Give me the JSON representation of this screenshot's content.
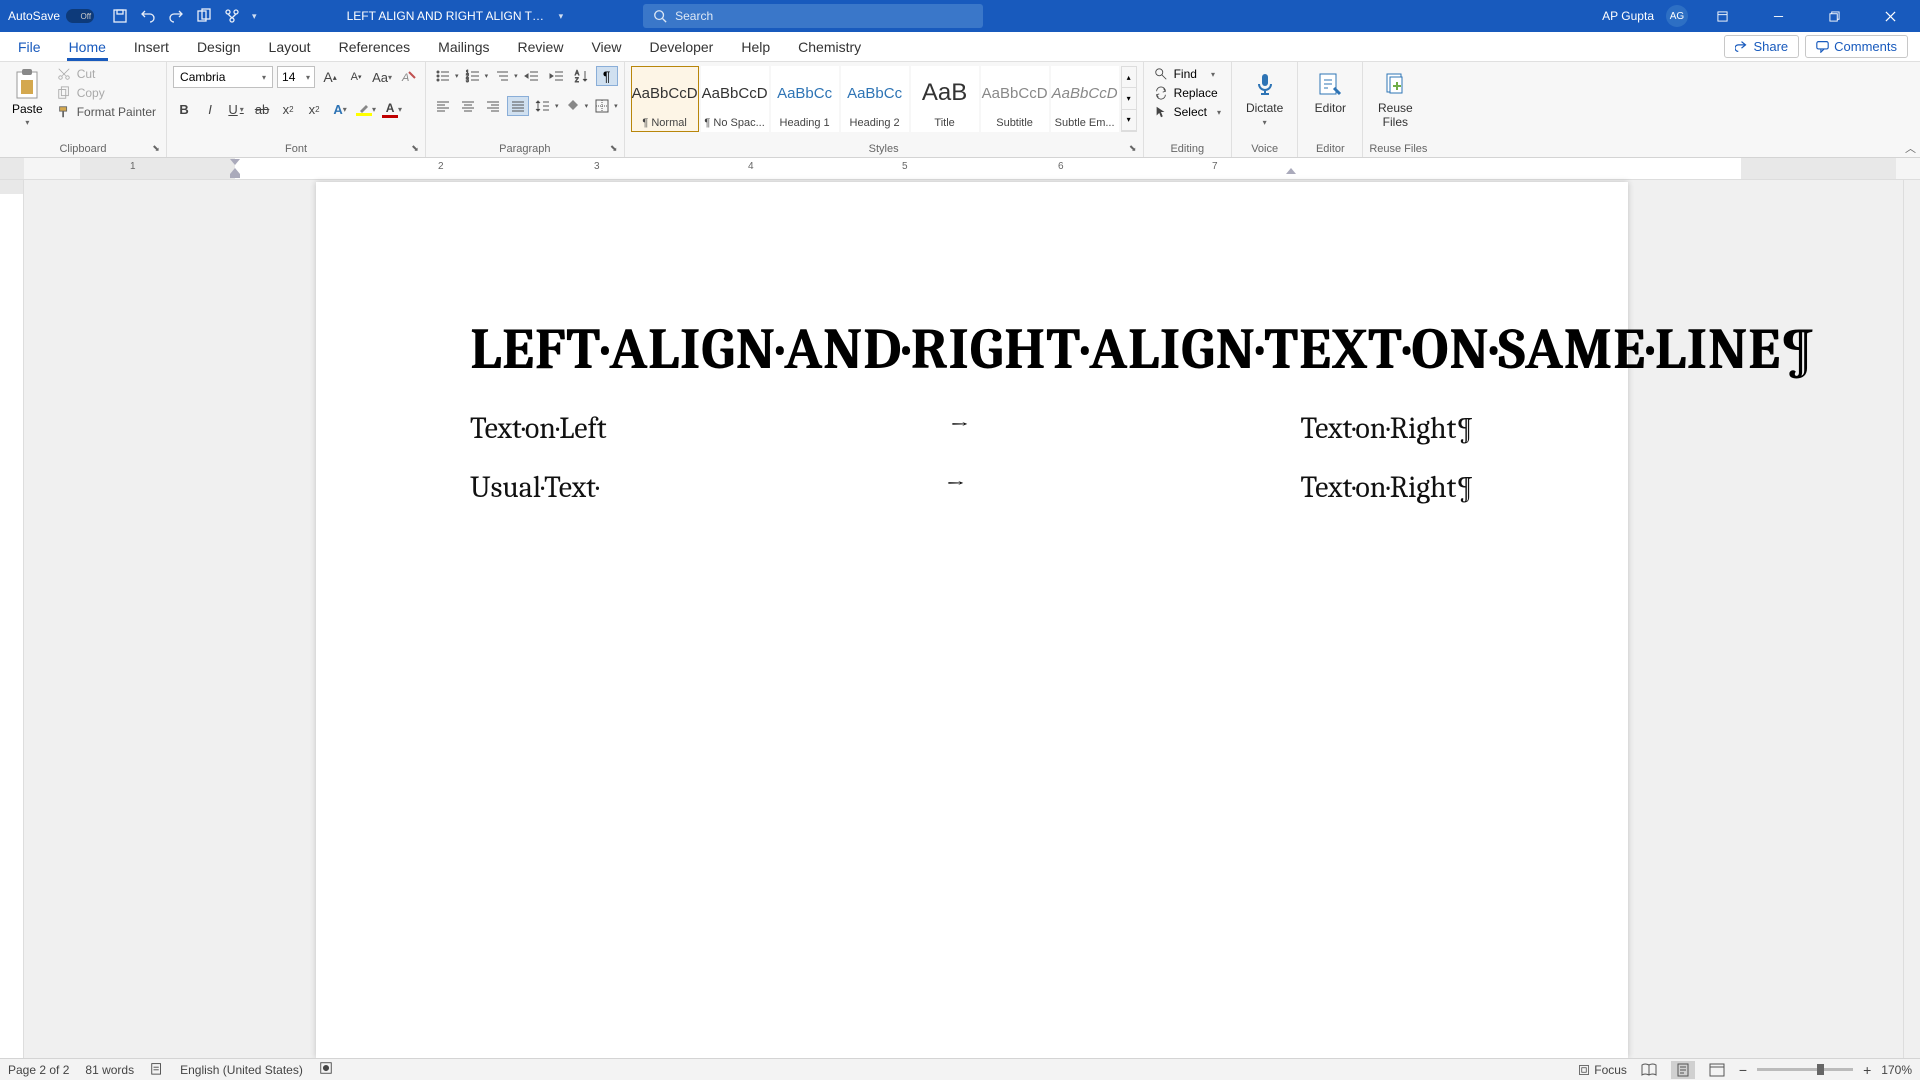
{
  "titlebar": {
    "autosave_label": "AutoSave",
    "autosave_state": "Off",
    "doc_title": "LEFT ALIGN AND RIGHT ALIGN TEXT...",
    "search_placeholder": "Search",
    "user_name": "AP Gupta",
    "user_initials": "AG"
  },
  "tabs": {
    "file": "File",
    "home": "Home",
    "insert": "Insert",
    "design": "Design",
    "layout": "Layout",
    "references": "References",
    "mailings": "Mailings",
    "review": "Review",
    "view": "View",
    "developer": "Developer",
    "help": "Help",
    "chemistry": "Chemistry",
    "share": "Share",
    "comments": "Comments"
  },
  "clipboard": {
    "paste": "Paste",
    "cut": "Cut",
    "copy": "Copy",
    "format_painter": "Format Painter",
    "group": "Clipboard"
  },
  "font": {
    "name": "Cambria",
    "size": "14",
    "group": "Font"
  },
  "paragraph": {
    "group": "Paragraph"
  },
  "styles": {
    "group": "Styles",
    "items": [
      {
        "preview": "AaBbCcD",
        "label": "¶ Normal",
        "cls": ""
      },
      {
        "preview": "AaBbCcD",
        "label": "¶ No Spac...",
        "cls": ""
      },
      {
        "preview": "AaBbCc",
        "label": "Heading 1",
        "cls": "heading"
      },
      {
        "preview": "AaBbCc",
        "label": "Heading 2",
        "cls": "heading"
      },
      {
        "preview": "AaB",
        "label": "Title",
        "cls": "title"
      },
      {
        "preview": "AaBbCcD",
        "label": "Subtitle",
        "cls": ""
      },
      {
        "preview": "AaBbCcD",
        "label": "Subtle Em...",
        "cls": "subtle"
      }
    ]
  },
  "editing": {
    "find": "Find",
    "replace": "Replace",
    "select": "Select",
    "group": "Editing"
  },
  "voice": {
    "dictate": "Dictate",
    "group": "Voice"
  },
  "editor": {
    "label": "Editor",
    "group": "Editor"
  },
  "reuse": {
    "label": "Reuse\nFiles",
    "group": "Reuse Files"
  },
  "ruler": {
    "marks": [
      "1",
      "2",
      "3",
      "4",
      "5",
      "6",
      "7"
    ]
  },
  "document": {
    "heading": "LEFT·ALIGN·AND·RIGHT·ALIGN·TEXT·ON·SAME·LINE¶",
    "lines": [
      {
        "left": "Text·on·Left",
        "arrow": "→",
        "right": "Text·on·Right¶"
      },
      {
        "left": "Usual·Text·",
        "arrow": "→",
        "right": "Text·on·Right¶"
      }
    ]
  },
  "statusbar": {
    "page": "Page 2 of 2",
    "words": "81 words",
    "language": "English (United States)",
    "focus": "Focus",
    "zoom": "170%"
  }
}
